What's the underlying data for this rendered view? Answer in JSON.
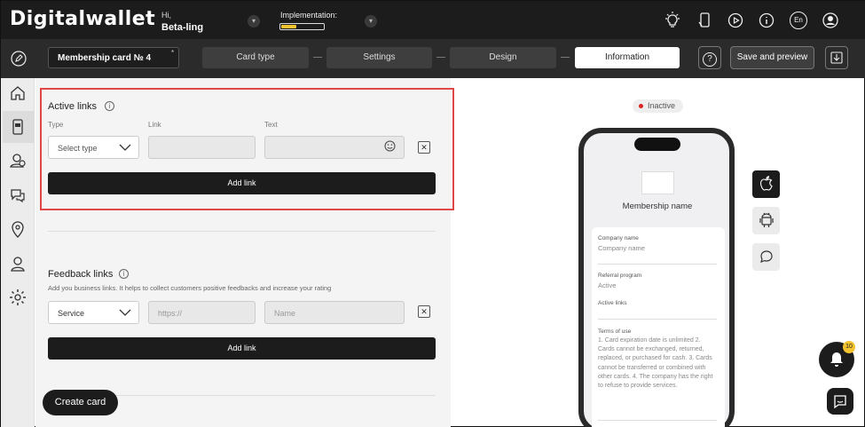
{
  "topbar": {
    "logo": "Digitalwallet",
    "greeting": "Hi,",
    "user_name": "Beta-ling",
    "implementation_label": "Implementation:",
    "implementation_progress": 0.35,
    "language": "En",
    "icons": [
      "lightbulb-icon",
      "phone-icon",
      "play-icon",
      "info-icon",
      "language-icon",
      "avatar-icon"
    ]
  },
  "toolbar": {
    "card_name": "Membership card № 4",
    "steps": [
      "Card type",
      "Settings",
      "Design",
      "Information"
    ],
    "active_step": "Information",
    "help_label": "?",
    "save_label": "Save and preview"
  },
  "sidebar": {
    "icons": [
      "home-icon",
      "card-icon",
      "users-icon",
      "chat-icon",
      "location-icon",
      "profile-icon",
      "settings-icon"
    ],
    "active": "card-icon"
  },
  "active_links": {
    "title": "Active links",
    "col_type": "Type",
    "col_link": "Link",
    "col_text": "Text",
    "type_placeholder": "Select type",
    "add_label": "Add link"
  },
  "feedback_links": {
    "title": "Feedback links",
    "description": "Add you business links. It helps to collect customers positive feedbacks and increase your rating",
    "type_value": "Service",
    "link_placeholder": "https://",
    "name_placeholder": "Name",
    "add_label": "Add link"
  },
  "create_card_label": "Create card",
  "preview": {
    "status": "Inactive",
    "status_color": "#dd2222",
    "name": "Membership name",
    "company_label": "Company name",
    "company_value": "Company name",
    "referral_label": "Referral program",
    "referral_value": "Active",
    "links_label": "Active links",
    "terms_label": "Terms of use",
    "terms_text": "1. Card expiration date is unlimited 2. Cards cannot be exchanged, returned, replaced, or purchased for cash. 3. Cards cannot be transferred or combined with other cards. 4. The company has the right to refuse to provide services."
  },
  "notifications": {
    "count": "10"
  }
}
